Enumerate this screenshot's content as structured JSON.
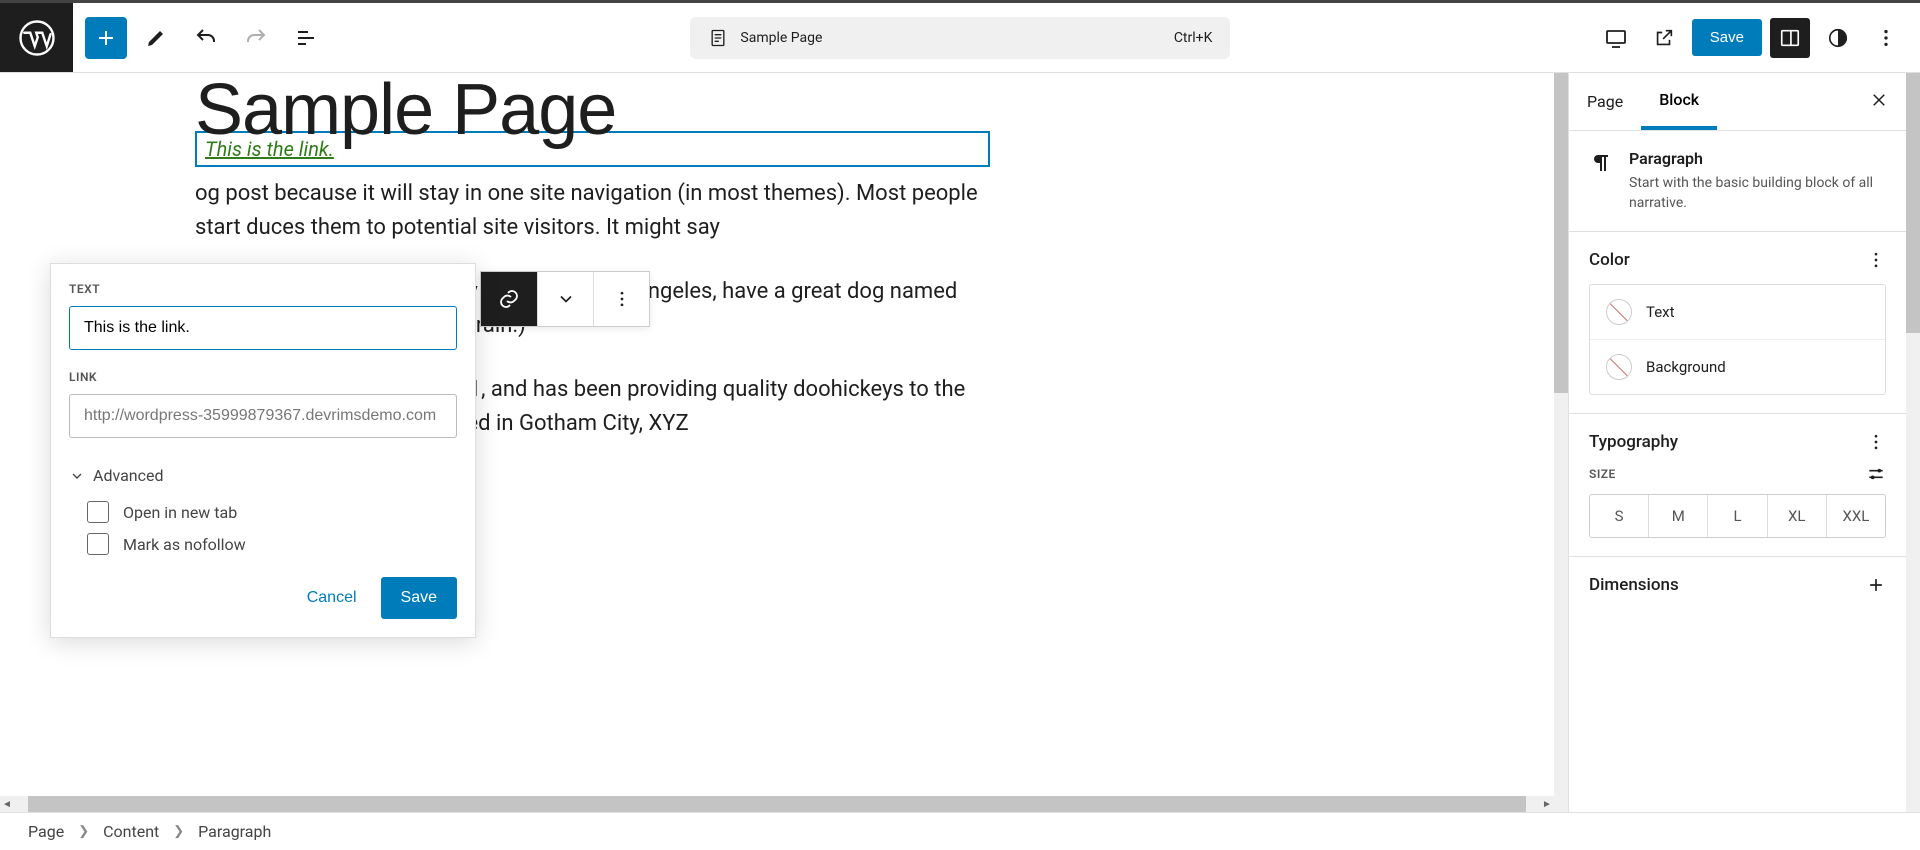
{
  "toolbar": {
    "doc_title": "Sample Page",
    "shortcut": "Ctrl+K",
    "save_label": "Save"
  },
  "editor": {
    "page_title": "Sample Page",
    "link_text": "This is the link.",
    "para1": "og post because it will stay in one site navigation (in most themes). Most people start duces them to potential site visitors. It might say",
    "para2": "nger by day, aspiring actor by night, and this is ngeles, have a great dog named Jack, and I like caught in the rain.)",
    "para3": "any was founded in 1971, and has been providing quality doohickeys to the public ever since. Located in Gotham City, XYZ"
  },
  "popover": {
    "text_label": "TEXT",
    "text_value": "This is the link.",
    "link_label": "LINK",
    "link_value": "http://wordpress-35999879367.devrimsdemo.com",
    "advanced": "Advanced",
    "open_new_tab": "Open in new tab",
    "nofollow": "Mark as nofollow",
    "cancel": "Cancel",
    "save": "Save"
  },
  "inspector": {
    "tabs": {
      "page": "Page",
      "block": "Block"
    },
    "block_name": "Paragraph",
    "block_desc": "Start with the basic building block of all narrative.",
    "color_title": "Color",
    "color_text": "Text",
    "color_bg": "Background",
    "typo_title": "Typography",
    "size_label": "SIZE",
    "sizes": [
      "S",
      "M",
      "L",
      "XL",
      "XXL"
    ],
    "dim_title": "Dimensions"
  },
  "breadcrumb": [
    "Page",
    "Content",
    "Paragraph"
  ]
}
